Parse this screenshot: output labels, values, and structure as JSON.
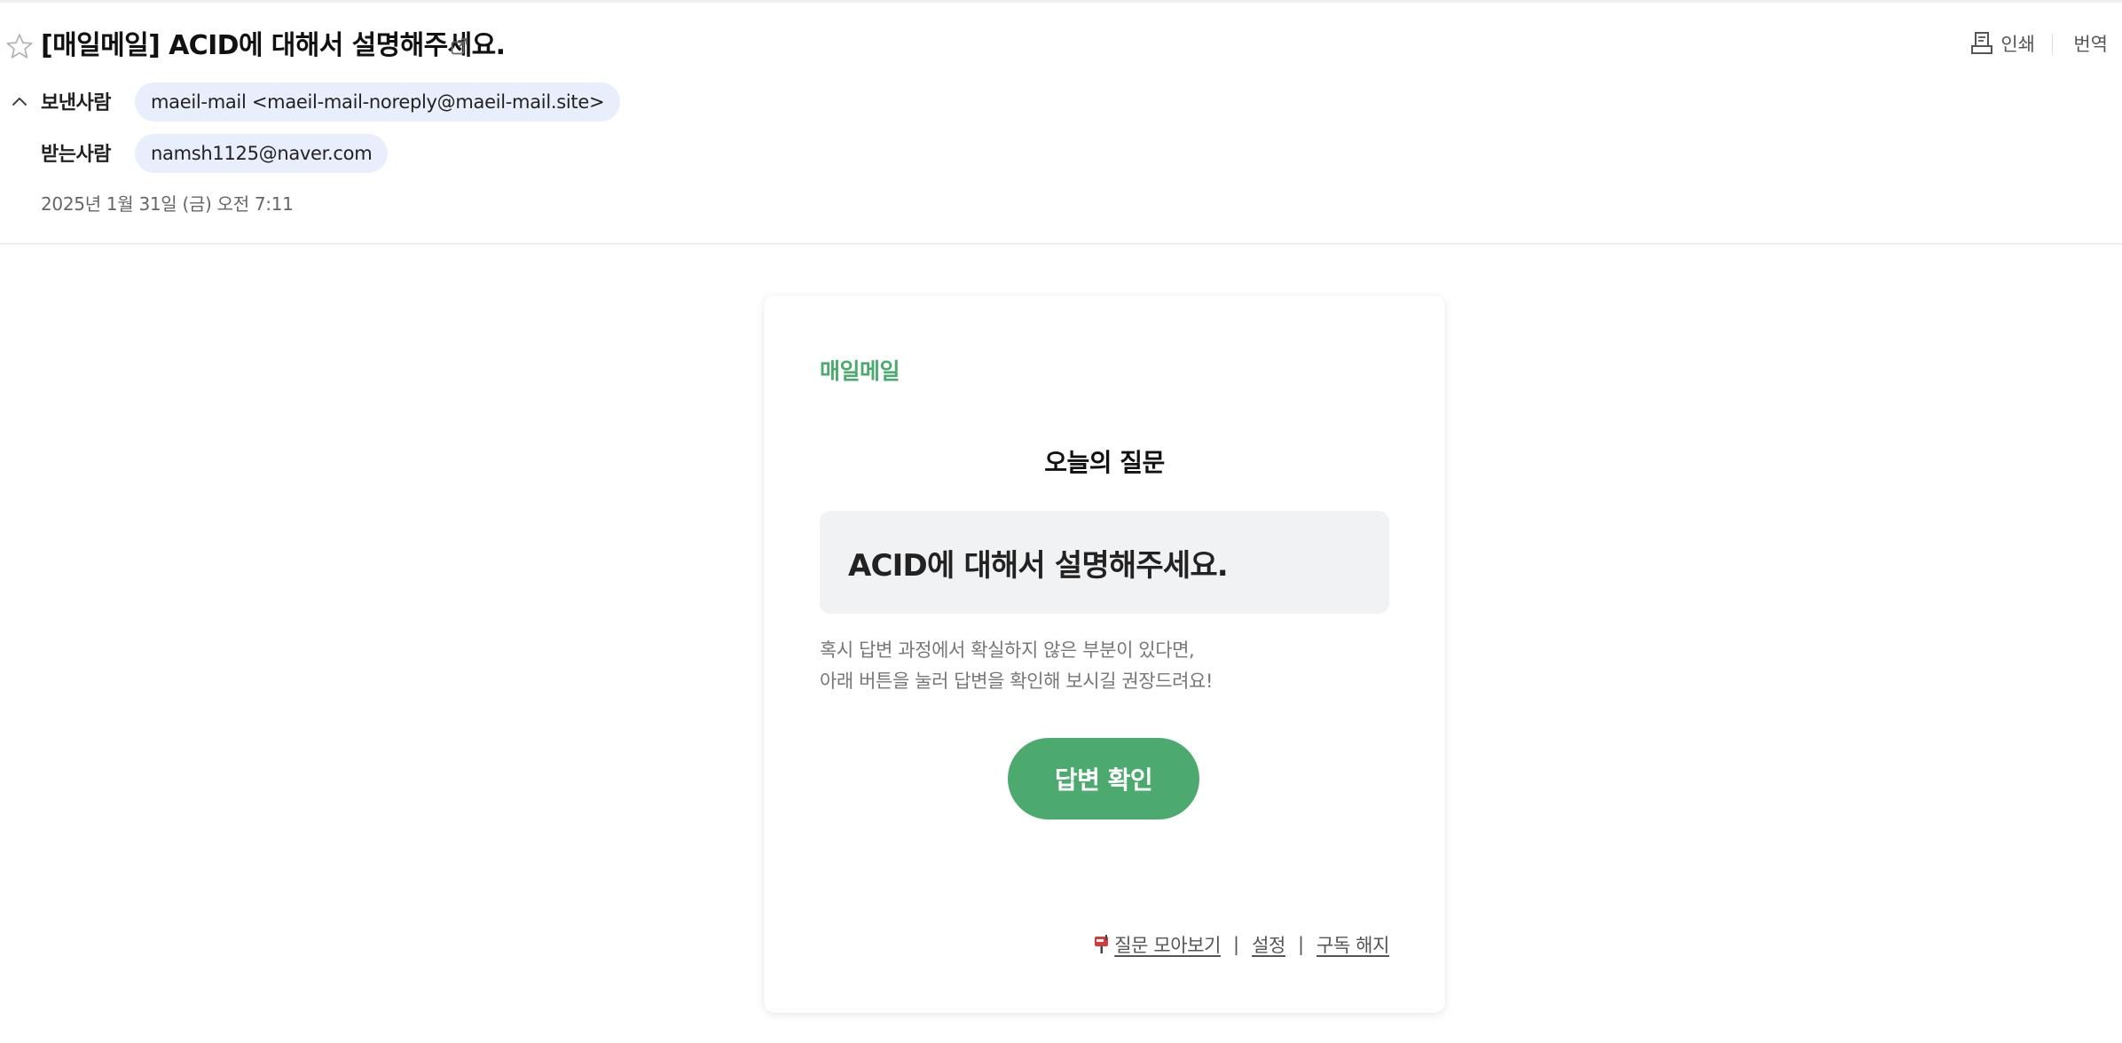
{
  "header": {
    "subject": "[매일메일] ACID에 대해서 설명해주세요.",
    "print_label": "인쇄",
    "translate_label": "번역",
    "from_label": "보낸사람",
    "from_value": "maeil-mail <maeil-mail-noreply@maeil-mail.site>",
    "to_label": "받는사람",
    "to_value": "namsh1125@naver.com",
    "date": "2025년 1월 31일 (금) 오전 7:11",
    "icons": [
      "star-icon",
      "external-link-icon",
      "print-icon",
      "chevron-up-icon"
    ]
  },
  "body": {
    "brand": "매일메일",
    "section_title": "오늘의 질문",
    "question": "ACID에 대해서 설명해주세요.",
    "guide_line1": "혹시 답변 과정에서 확실하지 않은 부분이 있다면,",
    "guide_line2": "아래 버튼을 눌러 답변을 확인해 보시길 권장드려요!",
    "answer_button": "답변 확인",
    "footer": {
      "links": [
        "질문 모아보기",
        "설정",
        "구독 해지"
      ],
      "separator": "|",
      "icon": "mailbox-icon"
    }
  },
  "colors": {
    "brand_green": "#4caa6f",
    "chip_bg": "#e8eefb",
    "question_bg": "#f1f2f4"
  }
}
